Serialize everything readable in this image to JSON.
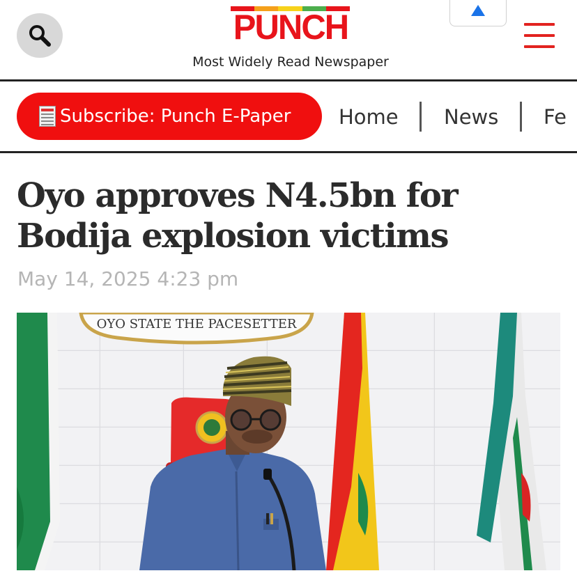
{
  "header": {
    "logo_text": "PUNCH",
    "tagline": "Most Widely Read Newspaper",
    "logo_stripe_colors": [
      "#e8141b",
      "#f5a01a",
      "#f7d21a",
      "#4cae4c",
      "#e8141b"
    ]
  },
  "nav": {
    "subscribe_label": "Subscribe: Punch E-Paper",
    "items": [
      "Home",
      "News",
      "Fe"
    ]
  },
  "article": {
    "headline": "Oyo approves N4.5bn for Bodija explosion victims",
    "date": "May 14, 2025 4:23 pm",
    "photo": {
      "plaque_text": "OYO STATE THE PACESETTER"
    }
  },
  "icons": {
    "search": "search-icon",
    "menu": "hamburger-menu-icon",
    "scroll_up": "caret-up-icon",
    "subscribe": "newspaper-icon"
  },
  "colors": {
    "brand_red": "#e8141b",
    "button_red": "#f00f0f",
    "scroll_up_blue": "#1a73e8"
  }
}
